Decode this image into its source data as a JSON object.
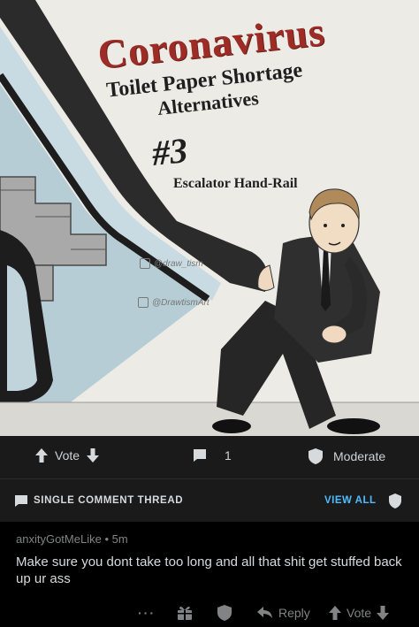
{
  "meme": {
    "title": "Coronavirus",
    "subtitle_line1": "Toilet Paper Shortage",
    "subtitle_line2": "Alternatives",
    "number": "#3",
    "caption": "Escalator Hand-Rail",
    "watermark1": "@draw_tism",
    "watermark2": "@DrawtismArt"
  },
  "post_actions": {
    "vote_label": "Vote",
    "comment_count": "1",
    "moderate_label": "Moderate"
  },
  "thread": {
    "label": "SINGLE COMMENT THREAD",
    "view_all": "VIEW ALL"
  },
  "comment": {
    "author": "anxityGotMeLike",
    "separator": "•",
    "age": "5m",
    "body": "Make sure you dont take too long and all that shit get stuffed back up ur ass",
    "more": "···",
    "reply_label": "Reply",
    "vote_label": "Vote"
  },
  "colors": {
    "background": "#000000",
    "bar": "#1a1a1b",
    "link_blue": "#4fbcff",
    "title_red": "#9c2c25"
  }
}
